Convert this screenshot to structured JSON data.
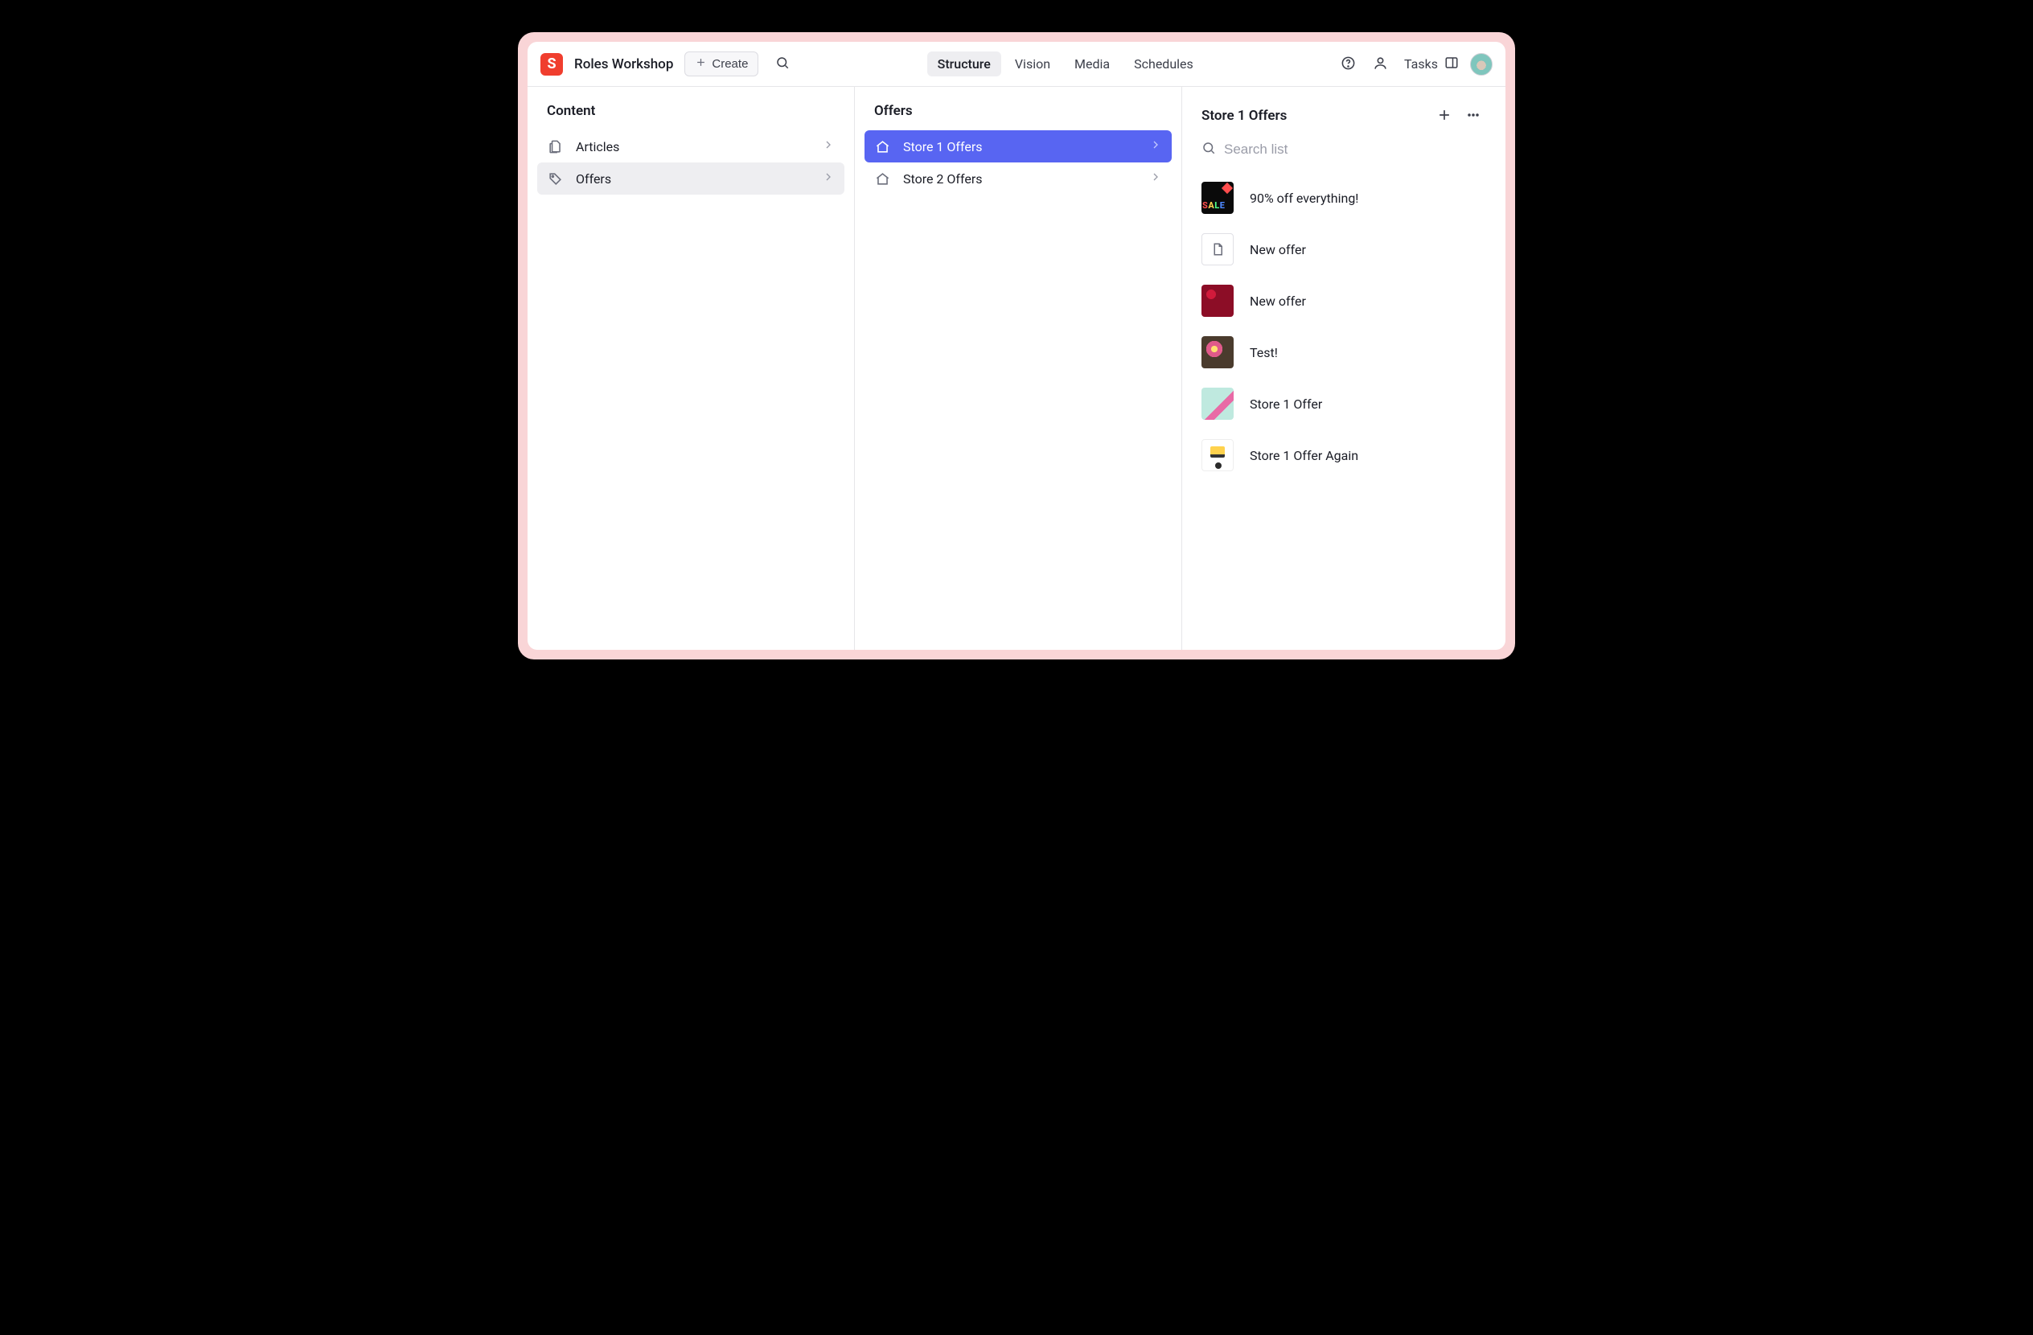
{
  "logo_letter": "S",
  "workspace_name": "Roles Workshop",
  "create_label": "Create",
  "nav_tabs": [
    {
      "label": "Structure",
      "active": true
    },
    {
      "label": "Vision",
      "active": false
    },
    {
      "label": "Media",
      "active": false
    },
    {
      "label": "Schedules",
      "active": false
    }
  ],
  "tasks_label": "Tasks",
  "panes": {
    "content": {
      "title": "Content",
      "items": [
        {
          "label": "Articles",
          "icon": "documents",
          "selected": false
        },
        {
          "label": "Offers",
          "icon": "tag",
          "selected": true
        }
      ]
    },
    "mid": {
      "title": "Offers",
      "items": [
        {
          "label": "Store 1 Offers",
          "icon": "home",
          "selected": true
        },
        {
          "label": "Store 2 Offers",
          "icon": "home",
          "selected": false
        }
      ]
    },
    "list": {
      "title": "Store 1 Offers",
      "search_placeholder": "Search list",
      "documents": [
        {
          "title": "90% off everything!",
          "thumb": "sale"
        },
        {
          "title": "New offer",
          "thumb": "empty"
        },
        {
          "title": "New offer",
          "thumb": "berries"
        },
        {
          "title": "Test!",
          "thumb": "candy"
        },
        {
          "title": "Store 1 Offer",
          "thumb": "flower"
        },
        {
          "title": "Store 1 Offer Again",
          "thumb": "desk"
        }
      ]
    }
  }
}
